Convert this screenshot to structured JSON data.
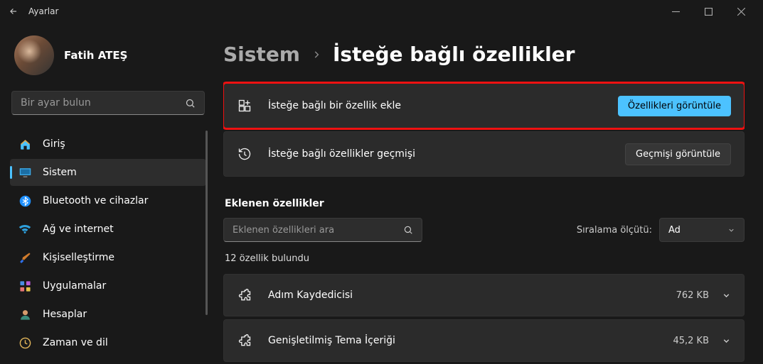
{
  "window": {
    "title": "Ayarlar"
  },
  "user": {
    "name": "Fatih ATEŞ"
  },
  "search": {
    "placeholder": "Bir ayar bulun"
  },
  "nav": [
    {
      "key": "home",
      "label": "Giriş"
    },
    {
      "key": "system",
      "label": "Sistem"
    },
    {
      "key": "bluetooth",
      "label": "Bluetooth ve cihazlar"
    },
    {
      "key": "network",
      "label": "Ağ ve internet"
    },
    {
      "key": "personal",
      "label": "Kişiselleştirme"
    },
    {
      "key": "apps",
      "label": "Uygulamalar"
    },
    {
      "key": "accounts",
      "label": "Hesaplar"
    },
    {
      "key": "time",
      "label": "Zaman ve dil"
    }
  ],
  "breadcrumb": {
    "parent": "Sistem",
    "current": "İsteğe bağlı özellikler"
  },
  "cards": {
    "add": {
      "label": "İsteğe bağlı bir özellik ekle",
      "button": "Özellikleri görüntüle"
    },
    "history": {
      "label": "İsteğe bağlı özellikler geçmişi",
      "button": "Geçmişi görüntüle"
    }
  },
  "installed": {
    "heading": "Eklenen özellikler",
    "search_placeholder": "Eklenen özellikleri ara",
    "sort_label": "Sıralama ölçütü:",
    "sort_value": "Ad",
    "count_text": "12 özellik bulundu",
    "items": [
      {
        "name": "Adım Kaydedicisi",
        "size": "762 KB"
      },
      {
        "name": "Genişletilmiş Tema İçeriği",
        "size": "45,2 KB"
      }
    ]
  }
}
